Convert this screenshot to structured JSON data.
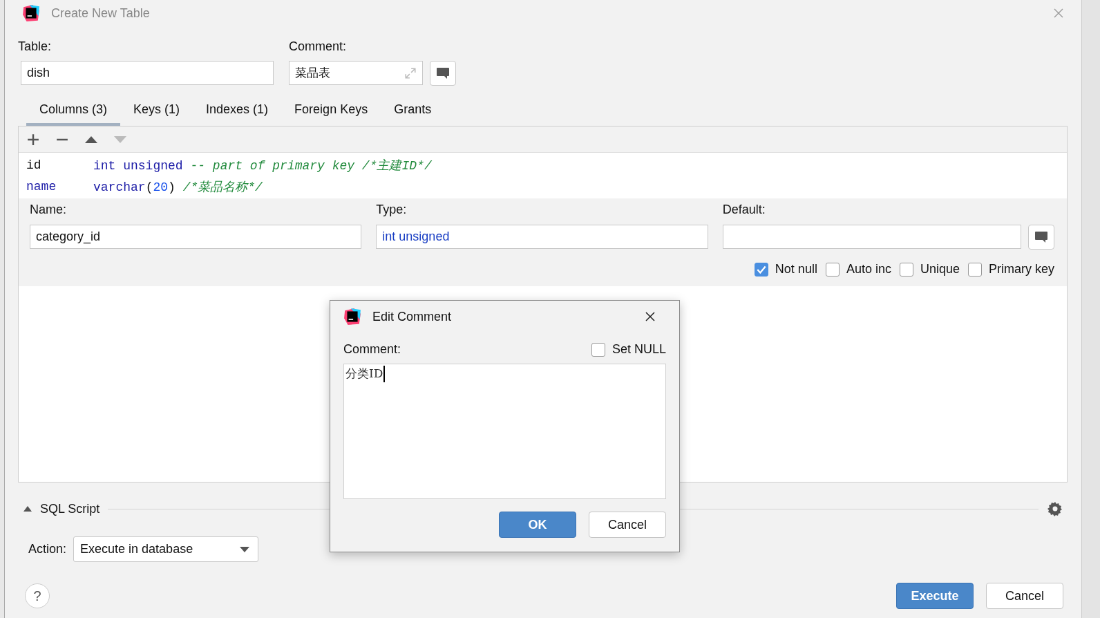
{
  "window": {
    "title": "Create New Table"
  },
  "table": {
    "label": "Table:",
    "value": "dish"
  },
  "comment": {
    "label": "Comment:",
    "value": "菜品表"
  },
  "tabs": [
    {
      "label": "Columns (3)",
      "selected": true
    },
    {
      "label": "Keys (1)",
      "selected": false
    },
    {
      "label": "Indexes (1)",
      "selected": false
    },
    {
      "label": "Foreign Keys",
      "selected": false
    },
    {
      "label": "Grants",
      "selected": false
    }
  ],
  "columns": [
    {
      "name": {
        "text": "id",
        "kind": "plain"
      },
      "segments": [
        {
          "text": "int unsigned",
          "kind": "keyword"
        },
        {
          "text": " -- part of primary key /*主建ID*/",
          "kind": "comment"
        }
      ]
    },
    {
      "name": {
        "text": "name",
        "kind": "keyword"
      },
      "segments": [
        {
          "text": "varchar",
          "kind": "keyword"
        },
        {
          "text": "(",
          "kind": "plain"
        },
        {
          "text": "20",
          "kind": "number"
        },
        {
          "text": ")",
          "kind": "plain"
        },
        {
          "text": " /*菜品名称*/",
          "kind": "comment"
        }
      ]
    }
  ],
  "editor": {
    "name": {
      "label": "Name:",
      "value": "category_id"
    },
    "type": {
      "label": "Type:",
      "value": "int unsigned"
    },
    "default": {
      "label": "Default:"
    },
    "options": [
      {
        "label": "Not null",
        "checked": true
      },
      {
        "label": "Auto inc",
        "checked": false
      },
      {
        "label": "Unique",
        "checked": false
      },
      {
        "label": "Primary key",
        "checked": false
      }
    ]
  },
  "sql_script": {
    "label": "SQL Script"
  },
  "action": {
    "label": "Action:",
    "value": "Execute in database"
  },
  "help": "?",
  "buttons": [
    {
      "label": "Execute",
      "primary": true
    },
    {
      "label": "Cancel",
      "primary": false
    }
  ],
  "dialog": {
    "title": "Edit Comment",
    "label": "Comment:",
    "set_null": {
      "label": "Set NULL",
      "checked": false
    },
    "value": "分类ID",
    "buttons": [
      {
        "label": "OK",
        "primary": true
      },
      {
        "label": "Cancel",
        "primary": false
      }
    ]
  }
}
